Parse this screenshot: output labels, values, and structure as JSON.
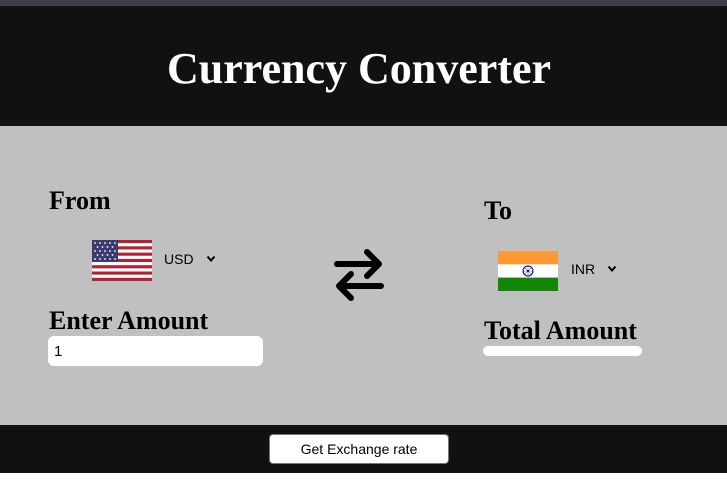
{
  "header": {
    "title": "Currency Converter"
  },
  "from": {
    "label": "From",
    "currency": "USD",
    "flag_icon": "us-flag-icon"
  },
  "to": {
    "label": "To",
    "currency": "INR",
    "flag_icon": "india-flag-icon"
  },
  "amount": {
    "label": "Enter Amount",
    "value": "1"
  },
  "total": {
    "label": "Total Amount",
    "value": ""
  },
  "swap_icon": "swap-arrows-icon",
  "button": {
    "label": "Get Exchange rate"
  },
  "colors": {
    "header_bg": "#111111",
    "main_bg": "#c0c0c0",
    "footer_bg": "#111111",
    "saffron": "#ff9933",
    "india_green": "#138808",
    "chakra_blue": "#000080"
  }
}
